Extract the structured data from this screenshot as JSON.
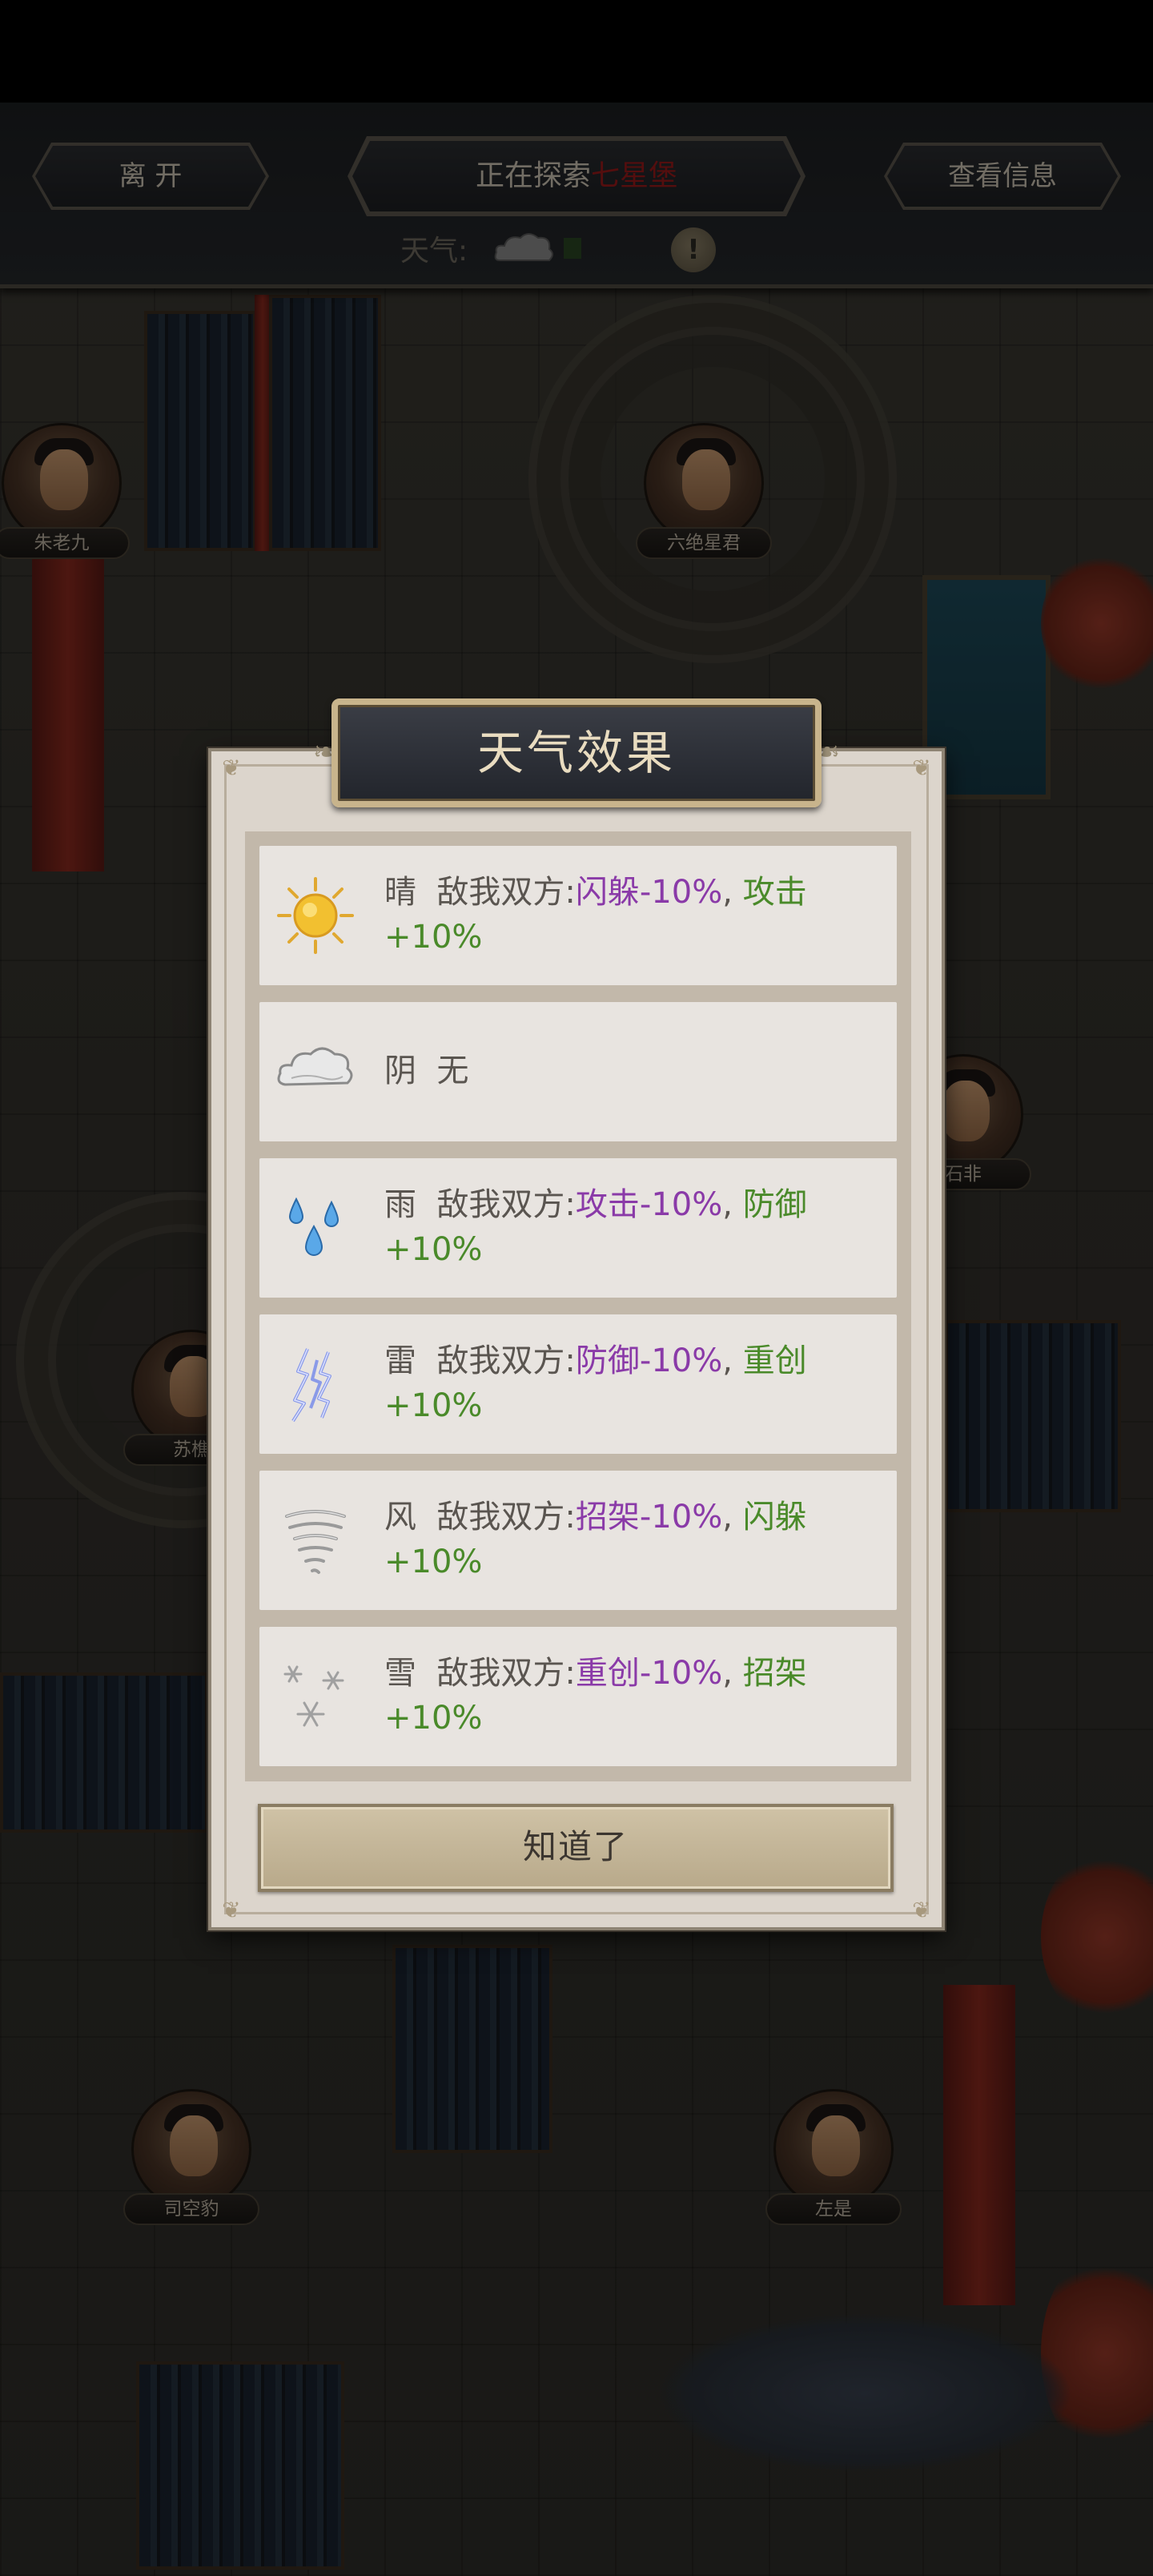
{
  "header": {
    "leave_label": "离 开",
    "explore_prefix": "正在探索",
    "explore_location": "七星堡",
    "view_info_label": "查看信息",
    "weather_label": "天气:",
    "weather_icon": "cloudy-icon"
  },
  "npcs": [
    {
      "name": "朱老九"
    },
    {
      "name": "六绝星君"
    },
    {
      "name": "石非"
    },
    {
      "name": "苏樵"
    },
    {
      "name": "司空豹"
    },
    {
      "name": "左是"
    }
  ],
  "dialog": {
    "title": "天气效果",
    "effects": [
      {
        "icon": "sun-icon",
        "label": "晴",
        "prefix": "敌我双方:",
        "neg": "闪躲-10%",
        "sep": ",",
        "pos_name": "攻击",
        "pos_value": "+10%"
      },
      {
        "icon": "cloud-icon",
        "label": "阴",
        "none": "无"
      },
      {
        "icon": "rain-icon",
        "label": "雨",
        "prefix": "敌我双方:",
        "neg": "攻击-10%",
        "sep": ",",
        "pos_name": "防御",
        "pos_value": "+10%"
      },
      {
        "icon": "thunder-icon",
        "label": "雷",
        "prefix": "敌我双方:",
        "neg": "防御-10%",
        "sep": ",",
        "pos_name": "重创",
        "pos_value": "+10%"
      },
      {
        "icon": "wind-icon",
        "label": "风",
        "prefix": "敌我双方:",
        "neg": "招架-10%",
        "sep": ",",
        "pos_name": "闪躲",
        "pos_value": "+10%"
      },
      {
        "icon": "snow-icon",
        "label": "雪",
        "prefix": "敌我双方:",
        "neg": "重创-10%",
        "sep": ",",
        "pos_name": "招架",
        "pos_value": "+10%"
      }
    ],
    "confirm_label": "知道了"
  },
  "colors": {
    "negative": "#8a3aa8",
    "positive": "#4a8a2a",
    "location": "#9a1a1a"
  }
}
